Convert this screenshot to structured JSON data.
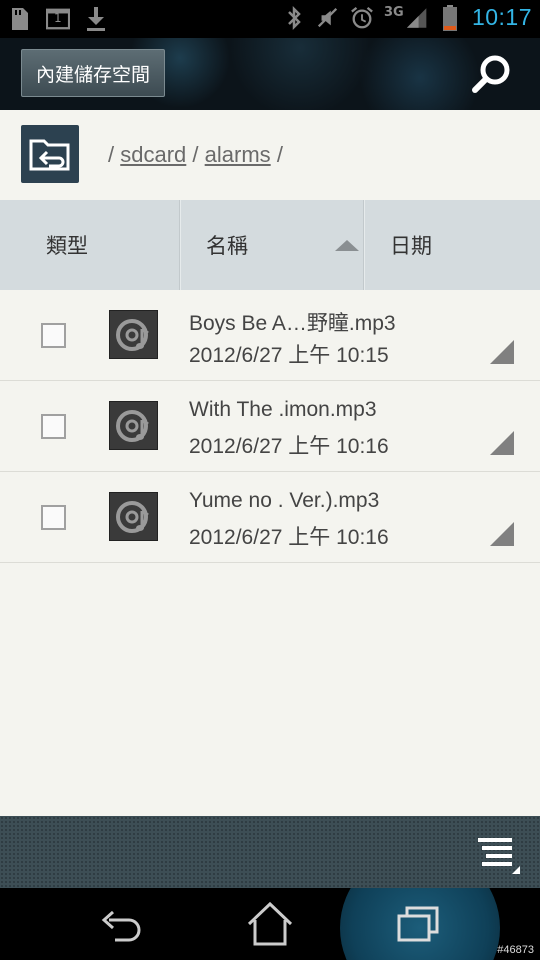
{
  "status_bar": {
    "left_icons": [
      "sd-card-icon",
      "notification-count-icon",
      "download-icon"
    ],
    "notification_count": "1",
    "right_icons": [
      "bluetooth-icon",
      "mute-icon",
      "alarm-icon",
      "signal-3g-icon",
      "battery-low-icon"
    ],
    "network": "3G",
    "time": "10:17"
  },
  "header": {
    "storage_label": "內建儲存空間",
    "search_icon": "search-icon"
  },
  "path_bar": {
    "up_icon": "folder-up-icon",
    "separator": "/",
    "crumbs": [
      "sdcard",
      "alarms"
    ]
  },
  "columns": {
    "type": "類型",
    "name": "名稱",
    "date": "日期"
  },
  "files": [
    {
      "name": "Boys Be A…野瞳.mp3",
      "date": "2012/6/27 上午 10:15",
      "icon": "music-disc-icon"
    },
    {
      "name": "With The .imon.mp3",
      "date": "2012/6/27 上午 10:16",
      "icon": "music-disc-icon"
    },
    {
      "name": "Yume no . Ver.).mp3",
      "date": "2012/6/27 上午 10:16",
      "icon": "music-disc-icon"
    }
  ],
  "toolbar": {
    "menu_icon": "list-menu-icon"
  },
  "nav": {
    "back_icon": "back-icon",
    "home_icon": "home-icon",
    "recent_icon": "recent-apps-icon"
  },
  "watermark": "#46873",
  "colors": {
    "clock": "#33b5e5",
    "header_bg": "#0c141a",
    "list_bg": "#f4f4ef",
    "column_header_bg": "#d4dbde",
    "up_button_bg": "#2c4150"
  }
}
